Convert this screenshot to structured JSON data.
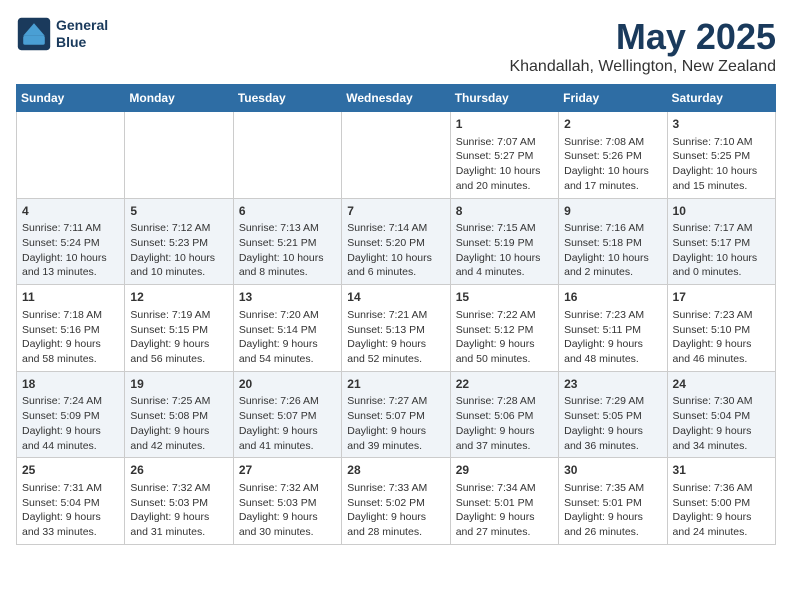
{
  "header": {
    "logo_line1": "General",
    "logo_line2": "Blue",
    "month": "May 2025",
    "location": "Khandallah, Wellington, New Zealand"
  },
  "weekdays": [
    "Sunday",
    "Monday",
    "Tuesday",
    "Wednesday",
    "Thursday",
    "Friday",
    "Saturday"
  ],
  "weeks": [
    [
      {
        "day": "",
        "content": ""
      },
      {
        "day": "",
        "content": ""
      },
      {
        "day": "",
        "content": ""
      },
      {
        "day": "",
        "content": ""
      },
      {
        "day": "1",
        "content": "Sunrise: 7:07 AM\nSunset: 5:27 PM\nDaylight: 10 hours\nand 20 minutes."
      },
      {
        "day": "2",
        "content": "Sunrise: 7:08 AM\nSunset: 5:26 PM\nDaylight: 10 hours\nand 17 minutes."
      },
      {
        "day": "3",
        "content": "Sunrise: 7:10 AM\nSunset: 5:25 PM\nDaylight: 10 hours\nand 15 minutes."
      }
    ],
    [
      {
        "day": "4",
        "content": "Sunrise: 7:11 AM\nSunset: 5:24 PM\nDaylight: 10 hours\nand 13 minutes."
      },
      {
        "day": "5",
        "content": "Sunrise: 7:12 AM\nSunset: 5:23 PM\nDaylight: 10 hours\nand 10 minutes."
      },
      {
        "day": "6",
        "content": "Sunrise: 7:13 AM\nSunset: 5:21 PM\nDaylight: 10 hours\nand 8 minutes."
      },
      {
        "day": "7",
        "content": "Sunrise: 7:14 AM\nSunset: 5:20 PM\nDaylight: 10 hours\nand 6 minutes."
      },
      {
        "day": "8",
        "content": "Sunrise: 7:15 AM\nSunset: 5:19 PM\nDaylight: 10 hours\nand 4 minutes."
      },
      {
        "day": "9",
        "content": "Sunrise: 7:16 AM\nSunset: 5:18 PM\nDaylight: 10 hours\nand 2 minutes."
      },
      {
        "day": "10",
        "content": "Sunrise: 7:17 AM\nSunset: 5:17 PM\nDaylight: 10 hours\nand 0 minutes."
      }
    ],
    [
      {
        "day": "11",
        "content": "Sunrise: 7:18 AM\nSunset: 5:16 PM\nDaylight: 9 hours\nand 58 minutes."
      },
      {
        "day": "12",
        "content": "Sunrise: 7:19 AM\nSunset: 5:15 PM\nDaylight: 9 hours\nand 56 minutes."
      },
      {
        "day": "13",
        "content": "Sunrise: 7:20 AM\nSunset: 5:14 PM\nDaylight: 9 hours\nand 54 minutes."
      },
      {
        "day": "14",
        "content": "Sunrise: 7:21 AM\nSunset: 5:13 PM\nDaylight: 9 hours\nand 52 minutes."
      },
      {
        "day": "15",
        "content": "Sunrise: 7:22 AM\nSunset: 5:12 PM\nDaylight: 9 hours\nand 50 minutes."
      },
      {
        "day": "16",
        "content": "Sunrise: 7:23 AM\nSunset: 5:11 PM\nDaylight: 9 hours\nand 48 minutes."
      },
      {
        "day": "17",
        "content": "Sunrise: 7:23 AM\nSunset: 5:10 PM\nDaylight: 9 hours\nand 46 minutes."
      }
    ],
    [
      {
        "day": "18",
        "content": "Sunrise: 7:24 AM\nSunset: 5:09 PM\nDaylight: 9 hours\nand 44 minutes."
      },
      {
        "day": "19",
        "content": "Sunrise: 7:25 AM\nSunset: 5:08 PM\nDaylight: 9 hours\nand 42 minutes."
      },
      {
        "day": "20",
        "content": "Sunrise: 7:26 AM\nSunset: 5:07 PM\nDaylight: 9 hours\nand 41 minutes."
      },
      {
        "day": "21",
        "content": "Sunrise: 7:27 AM\nSunset: 5:07 PM\nDaylight: 9 hours\nand 39 minutes."
      },
      {
        "day": "22",
        "content": "Sunrise: 7:28 AM\nSunset: 5:06 PM\nDaylight: 9 hours\nand 37 minutes."
      },
      {
        "day": "23",
        "content": "Sunrise: 7:29 AM\nSunset: 5:05 PM\nDaylight: 9 hours\nand 36 minutes."
      },
      {
        "day": "24",
        "content": "Sunrise: 7:30 AM\nSunset: 5:04 PM\nDaylight: 9 hours\nand 34 minutes."
      }
    ],
    [
      {
        "day": "25",
        "content": "Sunrise: 7:31 AM\nSunset: 5:04 PM\nDaylight: 9 hours\nand 33 minutes."
      },
      {
        "day": "26",
        "content": "Sunrise: 7:32 AM\nSunset: 5:03 PM\nDaylight: 9 hours\nand 31 minutes."
      },
      {
        "day": "27",
        "content": "Sunrise: 7:32 AM\nSunset: 5:03 PM\nDaylight: 9 hours\nand 30 minutes."
      },
      {
        "day": "28",
        "content": "Sunrise: 7:33 AM\nSunset: 5:02 PM\nDaylight: 9 hours\nand 28 minutes."
      },
      {
        "day": "29",
        "content": "Sunrise: 7:34 AM\nSunset: 5:01 PM\nDaylight: 9 hours\nand 27 minutes."
      },
      {
        "day": "30",
        "content": "Sunrise: 7:35 AM\nSunset: 5:01 PM\nDaylight: 9 hours\nand 26 minutes."
      },
      {
        "day": "31",
        "content": "Sunrise: 7:36 AM\nSunset: 5:00 PM\nDaylight: 9 hours\nand 24 minutes."
      }
    ]
  ]
}
